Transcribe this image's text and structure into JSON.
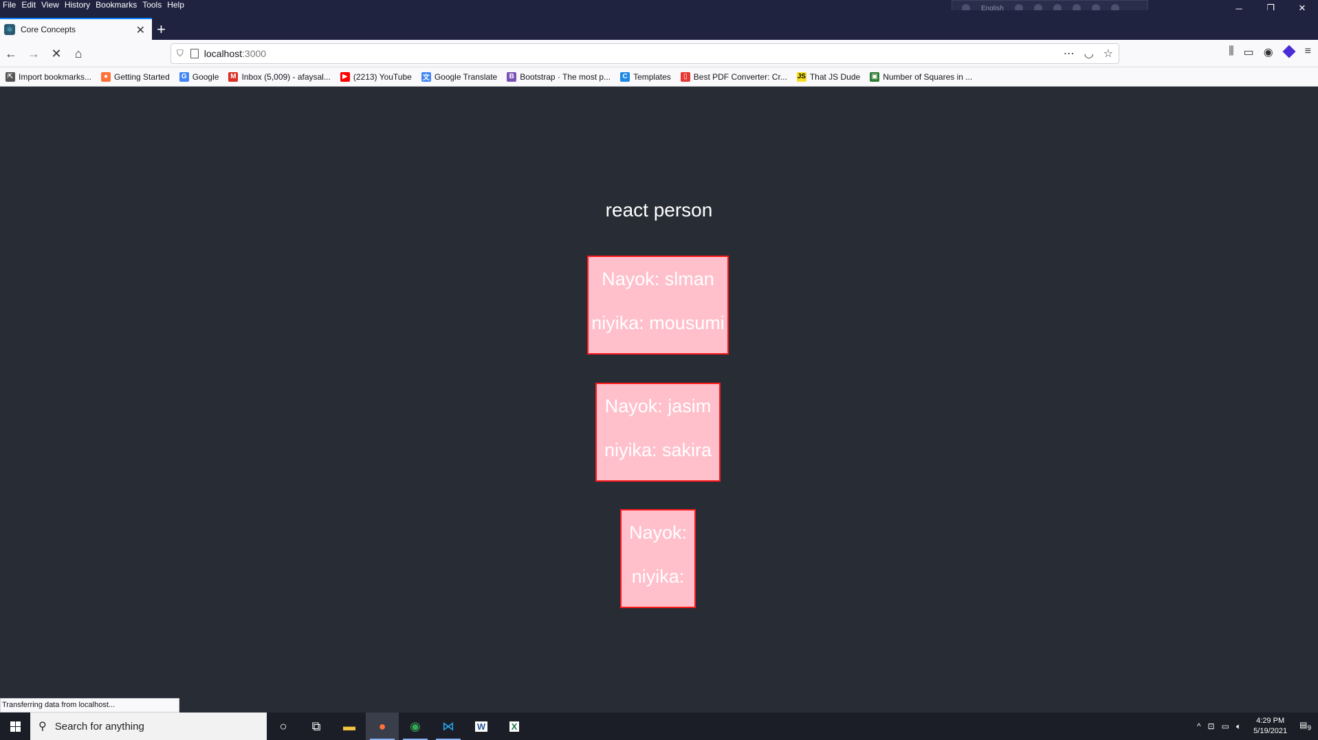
{
  "menu": [
    "File",
    "Edit",
    "View",
    "History",
    "Bookmarks",
    "Tools",
    "Help"
  ],
  "ime": {
    "lang": "English"
  },
  "window_controls": {
    "minimize": "─",
    "restore": "❐",
    "close": "✕"
  },
  "tab": {
    "title": "Core Concepts",
    "close": "✕",
    "new_tab": "+"
  },
  "url": {
    "host": "localhost",
    "port": ":3000"
  },
  "bookmarks": [
    {
      "label": "Import bookmarks...",
      "icon": "import-icon",
      "color": "#555555",
      "glyph": "⇱"
    },
    {
      "label": "Getting Started",
      "icon": "firefox-icon",
      "color": "#ff7139",
      "glyph": "●"
    },
    {
      "label": "Google",
      "icon": "google-icon",
      "color": "#4285f4",
      "glyph": "G"
    },
    {
      "label": "Inbox (5,009) - afaysal...",
      "icon": "gmail-icon",
      "color": "#d93025",
      "glyph": "M"
    },
    {
      "label": "(2213) YouTube",
      "icon": "youtube-icon",
      "color": "#ff0000",
      "glyph": "▶"
    },
    {
      "label": "Google Translate",
      "icon": "translate-icon",
      "color": "#4285f4",
      "glyph": "文"
    },
    {
      "label": "Bootstrap · The most p...",
      "icon": "bootstrap-icon",
      "color": "#7952b3",
      "glyph": "B"
    },
    {
      "label": "Templates",
      "icon": "templates-icon",
      "color": "#1e88e5",
      "glyph": "C"
    },
    {
      "label": "Best PDF Converter: Cr...",
      "icon": "pdf-icon",
      "color": "#e53935",
      "glyph": "▯"
    },
    {
      "label": "That JS Dude",
      "icon": "js-icon",
      "color": "#f7df1e",
      "glyph": "JS"
    },
    {
      "label": "Number of Squares in ...",
      "icon": "squares-icon",
      "color": "#2e7d32",
      "glyph": "▣"
    }
  ],
  "page": {
    "heading": "react person",
    "cards": [
      {
        "nayok": "Nayok: slman",
        "niyika": "niyika: mousumi"
      },
      {
        "nayok": "Nayok: jasim",
        "niyika": "niyika: sakira"
      },
      {
        "nayok": "Nayok:",
        "niyika": "niyika:"
      }
    ]
  },
  "status": "Transferring data from localhost...",
  "taskbar": {
    "search_placeholder": "Search for anything",
    "time": "4:29 PM",
    "date": "5/19/2021",
    "notifications": "9"
  }
}
